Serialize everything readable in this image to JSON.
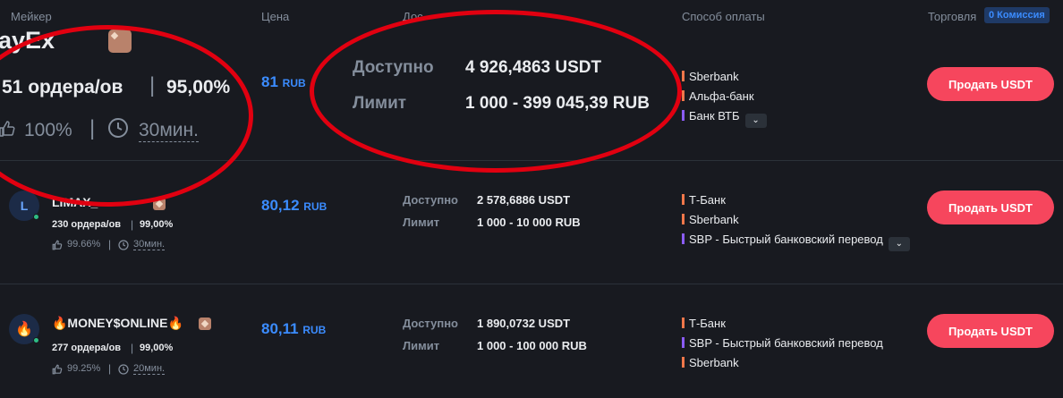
{
  "header": {
    "maker": "Мейкер",
    "price": "Цена",
    "available": "Дос",
    "payment": "Способ оплаты",
    "trade": "Торговля",
    "commission": "0 Комиссия"
  },
  "rows": [
    {
      "name": "ayEx",
      "orders": "51 ордера/ов",
      "completion": "95,00%",
      "rating": "100%",
      "time": "30мин.",
      "price": "81",
      "price_unit": "RUB",
      "available_label": "Доступно",
      "available_value": "4 926,4863 USDT",
      "limit_label": "Лимит",
      "limit_value": "1 000 - 399 045,39 RUB",
      "payments": [
        {
          "name": "Sberbank",
          "color": "#f0774a"
        },
        {
          "name": "Альфа-банк",
          "color": "#f0774a"
        },
        {
          "name": "Банк ВТБ",
          "color": "#8b5cf6"
        }
      ],
      "button": "Продать USDT"
    },
    {
      "avatar": "L",
      "name": "LIMAX_",
      "orders": "230 ордера/ов",
      "completion": "99,00%",
      "rating": "99.66%",
      "time": "30мин.",
      "price": "80,12",
      "price_unit": "RUB",
      "available_label": "Доступно",
      "available_value": "2 578,6886 USDT",
      "limit_label": "Лимит",
      "limit_value": "1 000 - 10 000 RUB",
      "payments": [
        {
          "name": "Т-Банк",
          "color": "#f0774a"
        },
        {
          "name": "Sberbank",
          "color": "#f0774a"
        },
        {
          "name": "SBP - Быстрый банковский перевод",
          "color": "#8b5cf6"
        }
      ],
      "button": "Продать USDT"
    },
    {
      "avatar": "🔥",
      "name": "🔥MONEY$ONLINE🔥",
      "orders": "277 ордера/ов",
      "completion": "99,00%",
      "rating": "99.25%",
      "time": "20мин.",
      "price": "80,11",
      "price_unit": "RUB",
      "available_label": "Доступно",
      "available_value": "1 890,0732 USDT",
      "limit_label": "Лимит",
      "limit_value": "1 000 - 100 000 RUB",
      "payments": [
        {
          "name": "Т-Банк",
          "color": "#f0774a"
        },
        {
          "name": "SBP - Быстрый банковский перевод",
          "color": "#8b5cf6"
        },
        {
          "name": "Sberbank",
          "color": "#f0774a"
        }
      ],
      "button": "Продать USDT"
    }
  ],
  "icons": {
    "verified": "verified-badge-icon",
    "thumb": "thumbs-up-icon",
    "clock": "clock-icon",
    "chevron": "chevron-down-icon"
  },
  "colors": {
    "background": "#181a20",
    "price": "#3b8cff",
    "sell_button": "#f6465d",
    "annotation": "#e10010"
  }
}
